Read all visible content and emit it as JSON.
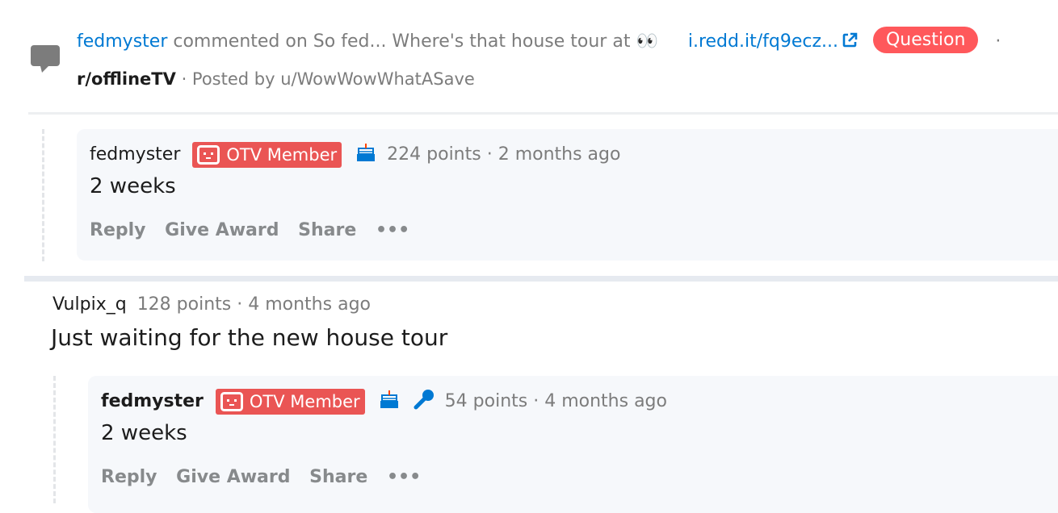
{
  "header": {
    "commenter": "fedmyster",
    "commented_on": "commented on",
    "post_title": "So fed... Where's that house tour at 👀",
    "link": "i.redd.it/fq9ecz...",
    "flair": "Question",
    "dot": "·",
    "subreddit": "r/offlineTV",
    "posted_by": "· Posted by u/WowWowWhatASave"
  },
  "comment1": {
    "author": "fedmyster",
    "flair": "OTV Member",
    "points": "224 points",
    "time": "· 2 months ago",
    "body": "2 weeks",
    "actions": [
      "Reply",
      "Give Award",
      "Share",
      "•••"
    ]
  },
  "comment2": {
    "author": "Vulpix_q",
    "points": "128 points",
    "time": "· 4 months ago",
    "body": "Just waiting for the new house tour"
  },
  "comment3": {
    "author": "fedmyster",
    "flair": "OTV Member",
    "points": "54 points",
    "time": "· 4 months ago",
    "body": "2 weeks",
    "actions": [
      "Reply",
      "Give Award",
      "Share",
      "•••"
    ]
  },
  "colors": {
    "link": "#0079d3",
    "flair_question": "#ff585b",
    "flair_otv": "#ea5554",
    "comment_bg": "#f6f8fb"
  }
}
